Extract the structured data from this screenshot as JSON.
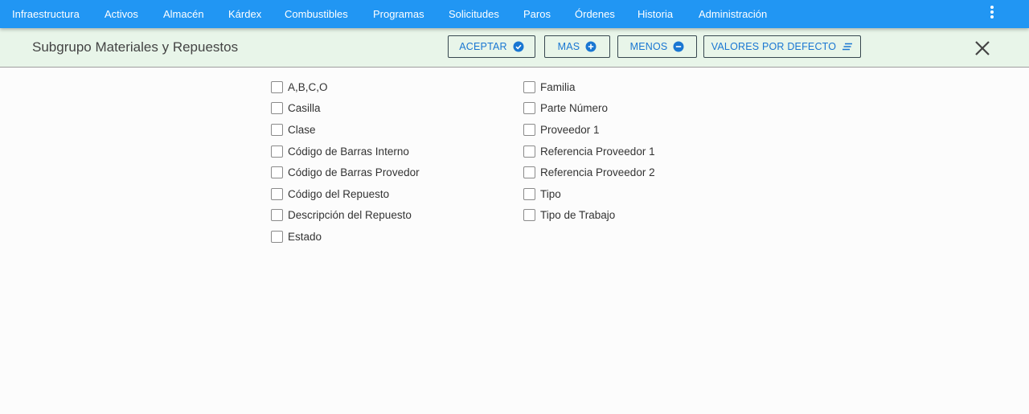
{
  "nav": {
    "items": [
      "Infraestructura",
      "Activos",
      "Almacén",
      "Kárdex",
      "Combustibles",
      "Programas",
      "Solicitudes",
      "Paros",
      "Órdenes",
      "Historia",
      "Administración"
    ]
  },
  "header": {
    "title": "Subgrupo Materiales y Repuestos",
    "accept_label": "ACEPTAR",
    "more_label": "MAS",
    "less_label": "MENOS",
    "defaults_label": "VALORES POR DEFECTO"
  },
  "options": {
    "left": [
      {
        "label": "A,B,C,O",
        "checked": false
      },
      {
        "label": "Casilla",
        "checked": false
      },
      {
        "label": "Clase",
        "checked": false
      },
      {
        "label": "Código de Barras Interno",
        "checked": false
      },
      {
        "label": "Código de Barras Provedor",
        "checked": false
      },
      {
        "label": "Código del Repuesto",
        "checked": false
      },
      {
        "label": "Descripción del Repuesto",
        "checked": false
      },
      {
        "label": "Estado",
        "checked": false
      }
    ],
    "right": [
      {
        "label": "Familia",
        "checked": false
      },
      {
        "label": "Parte Número",
        "checked": false
      },
      {
        "label": "Proveedor 1",
        "checked": false
      },
      {
        "label": "Referencia Proveedor 1",
        "checked": false
      },
      {
        "label": "Referencia Proveedor 2",
        "checked": false
      },
      {
        "label": "Tipo",
        "checked": false
      },
      {
        "label": "Tipo de Trabajo",
        "checked": false
      }
    ]
  },
  "colors": {
    "nav_bg": "#2196f3",
    "header_bg": "#e8f5e9",
    "accent": "#1976d2"
  }
}
